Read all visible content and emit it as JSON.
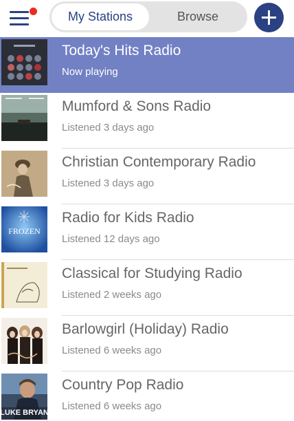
{
  "header": {
    "tabs": [
      {
        "label": "My Stations",
        "active": true
      },
      {
        "label": "Browse",
        "active": false
      }
    ],
    "menu_icon": "hamburger-menu-icon",
    "notification_dot_color": "#ee2a24",
    "add_icon": "plus-icon"
  },
  "colors": {
    "accent": "#2a4183",
    "selected_row": "#7280c4"
  },
  "stations": [
    {
      "name": "Today's Hits Radio",
      "status": "Now playing",
      "active": true
    },
    {
      "name": "Mumford & Sons Radio",
      "status": "Listened 3 days ago",
      "active": false
    },
    {
      "name": "Christian Contemporary Radio",
      "status": "Listened 3 days ago",
      "active": false
    },
    {
      "name": "Radio for Kids Radio",
      "status": "Listened 12 days ago",
      "active": false
    },
    {
      "name": "Classical for Studying Radio",
      "status": "Listened 2 weeks ago",
      "active": false
    },
    {
      "name": "Barlowgirl (Holiday) Radio",
      "status": "Listened 6 weeks ago",
      "active": false
    },
    {
      "name": "Country Pop Radio",
      "status": "Listened 6 weeks ago",
      "active": false
    }
  ],
  "album_art_text": {
    "frozen": "FROZEN",
    "luke_bryan": "LUKE BRYAN"
  }
}
